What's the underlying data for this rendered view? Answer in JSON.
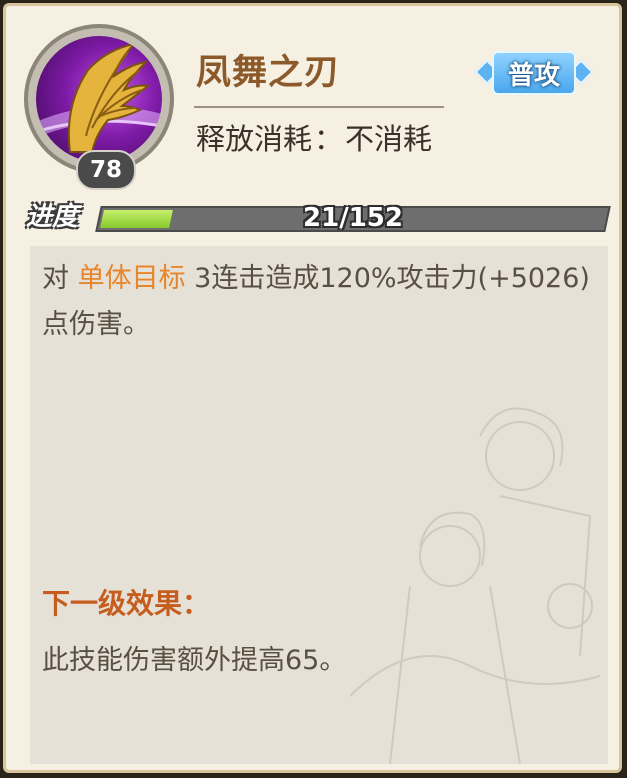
{
  "skill": {
    "name": "凤舞之刃",
    "level": "78",
    "icon": "golden-wing-icon",
    "cost_label": "释放消耗",
    "cost_sep": "：",
    "cost_value": "不消耗",
    "type_label": "普攻"
  },
  "progress": {
    "label": "进度",
    "text": "21/152",
    "current": 21,
    "max": 152
  },
  "description": {
    "prefix": "对 ",
    "highlight": "单体目标",
    "suffix": " 3连击造成120%攻击力(+5026)点伤害。"
  },
  "next_level": {
    "title": "下一级效果：",
    "text": "此技能伤害额外提高65。"
  },
  "colors": {
    "name": "#8c5a2a",
    "highlight": "#e6862c",
    "next_title": "#c55d1e",
    "progress_fill": "#9ad83c",
    "badge": "#4aa7ec"
  }
}
